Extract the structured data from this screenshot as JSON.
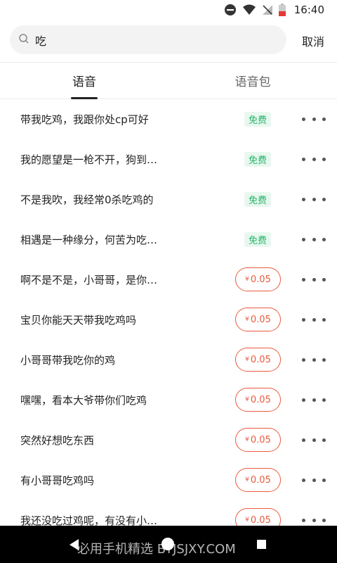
{
  "status_bar": {
    "time": "16:40"
  },
  "search": {
    "value": "吃",
    "cancel_label": "取消"
  },
  "tabs": [
    {
      "label": "语音",
      "active": true
    },
    {
      "label": "语音包",
      "active": false
    }
  ],
  "items": [
    {
      "title": "带我吃鸡，我跟你处cp可好",
      "badge": "免费",
      "type": "free"
    },
    {
      "title": "我的愿望是一枪不开，狗到…",
      "badge": "免费",
      "type": "free"
    },
    {
      "title": "不是我吹，我经常0杀吃鸡的",
      "badge": "免费",
      "type": "free"
    },
    {
      "title": "相遇是一种缘分，何苦为吃…",
      "badge": "免费",
      "type": "free"
    },
    {
      "title": "啊不是不是，小哥哥，是你…",
      "badge": "0.05",
      "type": "price"
    },
    {
      "title": "宝贝你能天天带我吃鸡吗",
      "badge": "0.05",
      "type": "price"
    },
    {
      "title": "小哥哥带我吃你的鸡",
      "badge": "0.05",
      "type": "price"
    },
    {
      "title": "嘿嘿，看本大爷带你们吃鸡",
      "badge": "0.05",
      "type": "price"
    },
    {
      "title": "突然好想吃东西",
      "badge": "0.05",
      "type": "price"
    },
    {
      "title": "有小哥哥吃鸡吗",
      "badge": "0.05",
      "type": "price"
    },
    {
      "title": "我还没吃过鸡呢，有没有小…",
      "badge": "0.05",
      "type": "price"
    }
  ],
  "currency_symbol": "¥",
  "watermark": "必用手机精选 BYJSJXY.COM",
  "colors": {
    "free_text": "#27b36a",
    "free_bg": "#e8f8ef",
    "price": "#ea5a3c"
  }
}
